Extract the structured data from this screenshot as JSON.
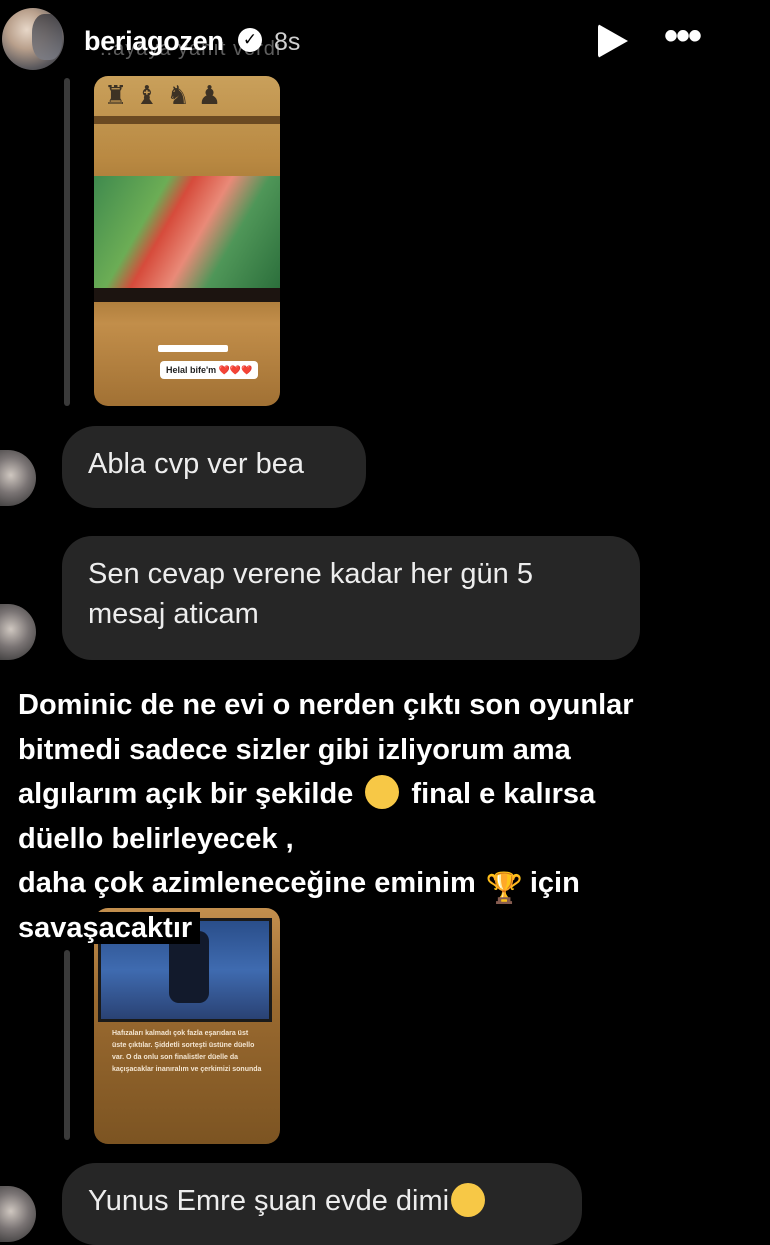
{
  "header": {
    "username": "beriagozen",
    "verified_icon": "verified-check-icon",
    "time_ago": "8s",
    "ghost_text": "..ayaya yanıt verdi",
    "play_icon": "play-icon",
    "more_icon": "more-dots-icon"
  },
  "story_thumb_1": {
    "small_sticker": "",
    "sticker": "Helal bife'm ❤️❤️❤️"
  },
  "messages": [
    {
      "text": "Abla cvp ver bea"
    },
    {
      "text": "Sen cevap verene kadar her gün 5 mesaj aticam"
    }
  ],
  "overlay": {
    "line1": "Dominic de ne evi o nerden çıktı son oyunlar",
    "line2": "bitmedi sadece sizler gibi izliyorum ama",
    "line3a": "algılarım açık bir şekilde",
    "line3_emoji": "smiling-face-icon",
    "line3b": "final e kalırsa",
    "line4": "düello belirleyecek ,",
    "line5a": "daha çok azimleneceğine eminim",
    "line5_emoji": "trophy-icon",
    "line5b": "için",
    "line6": "savaşacaktır"
  },
  "story_thumb_2": {
    "caption": "Hafızaları kalmadı çok fazla eşarıdara üst üste çıktılar. Şiddetli sorteşti üstüne düello var. O da onlu son finalistler düelle da kaçışacaklar inanıralım ve çerkimizi sonunda"
  },
  "last_message": {
    "text": "Yunus Emre şuan evde dimi",
    "emoji": "crying-face-icon"
  },
  "colors": {
    "background": "#000000",
    "bubble": "#262626",
    "text": "#ffffff"
  }
}
